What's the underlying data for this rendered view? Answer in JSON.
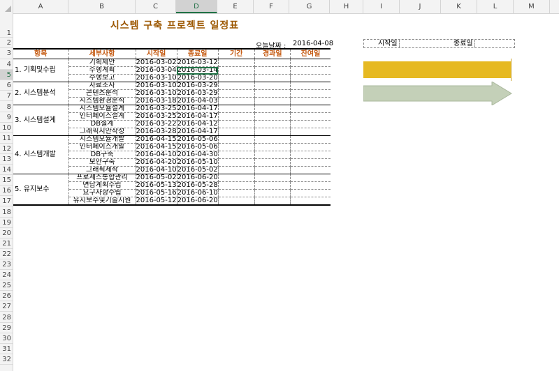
{
  "columns": [
    "A",
    "B",
    "C",
    "D",
    "E",
    "F",
    "G",
    "H",
    "I",
    "J",
    "K",
    "L",
    "M"
  ],
  "rows": [
    "1",
    "2",
    "3",
    "4",
    "5",
    "6",
    "7",
    "8",
    "9",
    "10",
    "11",
    "12",
    "13",
    "14",
    "15",
    "16",
    "17",
    "18",
    "19",
    "20",
    "21",
    "22",
    "23",
    "24",
    "25",
    "26",
    "27",
    "28",
    "29",
    "30",
    "31",
    "32"
  ],
  "title": "시스템 구축 프로젝트 일정표",
  "today": {
    "label": "오늘날짜 :",
    "value": "2016-04-08"
  },
  "headers": {
    "item": "항목",
    "detail": "세부사항",
    "start": "시작일",
    "end": "종료일",
    "period": "기간",
    "elapsed": "경과일",
    "remaining": "잔여일"
  },
  "groups": [
    {
      "name": "1. 기획및수립",
      "tasks": [
        {
          "detail": "기획제안",
          "start": "2016-03-02",
          "end": "2016-03-12"
        },
        {
          "detail": "수행계획",
          "start": "2016-03-04",
          "end": "2016-03-14"
        },
        {
          "detail": "수행보고",
          "start": "2016-03-10",
          "end": "2016-03-20"
        }
      ]
    },
    {
      "name": "2. 시스템분석",
      "tasks": [
        {
          "detail": "자료조사",
          "start": "2016-03-10",
          "end": "2016-03-29"
        },
        {
          "detail": "콘텐츠분석",
          "start": "2016-03-10",
          "end": "2016-03-29"
        },
        {
          "detail": "시스템환경분석",
          "start": "2016-03-18",
          "end": "2016-04-03"
        }
      ]
    },
    {
      "name": "3. 시스템설계",
      "tasks": [
        {
          "detail": "시스템모듈설계",
          "start": "2016-03-25",
          "end": "2016-04-17"
        },
        {
          "detail": "인터페이스설계",
          "start": "2016-03-25",
          "end": "2016-04-17"
        },
        {
          "detail": "DB설계",
          "start": "2016-03-22",
          "end": "2016-04-12"
        },
        {
          "detail": "그래픽시안작성",
          "start": "2016-03-28",
          "end": "2016-04-17"
        }
      ]
    },
    {
      "name": "4. 시스템개발",
      "tasks": [
        {
          "detail": "시스템모듈개발",
          "start": "2016-04-15",
          "end": "2016-05-06"
        },
        {
          "detail": "인터페이스개발",
          "start": "2016-04-15",
          "end": "2016-05-06"
        },
        {
          "detail": "DB구축",
          "start": "2016-04-10",
          "end": "2016-04-30"
        },
        {
          "detail": "보안구축",
          "start": "2016-04-20",
          "end": "2016-05-10"
        },
        {
          "detail": "그래픽제작",
          "start": "2016-04-10",
          "end": "2016-05-02"
        }
      ]
    },
    {
      "name": "5. 유지보수",
      "tasks": [
        {
          "detail": "프로세스통합관리",
          "start": "2016-05-02",
          "end": "2016-06-20"
        },
        {
          "detail": "면담계획수립",
          "start": "2016-05-13",
          "end": "2016-05-28"
        },
        {
          "detail": "요구사항수립",
          "start": "2016-05-16",
          "end": "2016-06-10"
        },
        {
          "detail": "유지보수및기술지원",
          "start": "2016-05-12",
          "end": "2016-06-20"
        }
      ]
    }
  ],
  "gantt_header": {
    "start_label": "시작일",
    "end_label": "종료일"
  },
  "colors": {
    "bar": "#e6b922",
    "arrow": "#c4d0b8",
    "header_text": "#c55a11",
    "title": "#9c5700",
    "selection": "#217346"
  }
}
